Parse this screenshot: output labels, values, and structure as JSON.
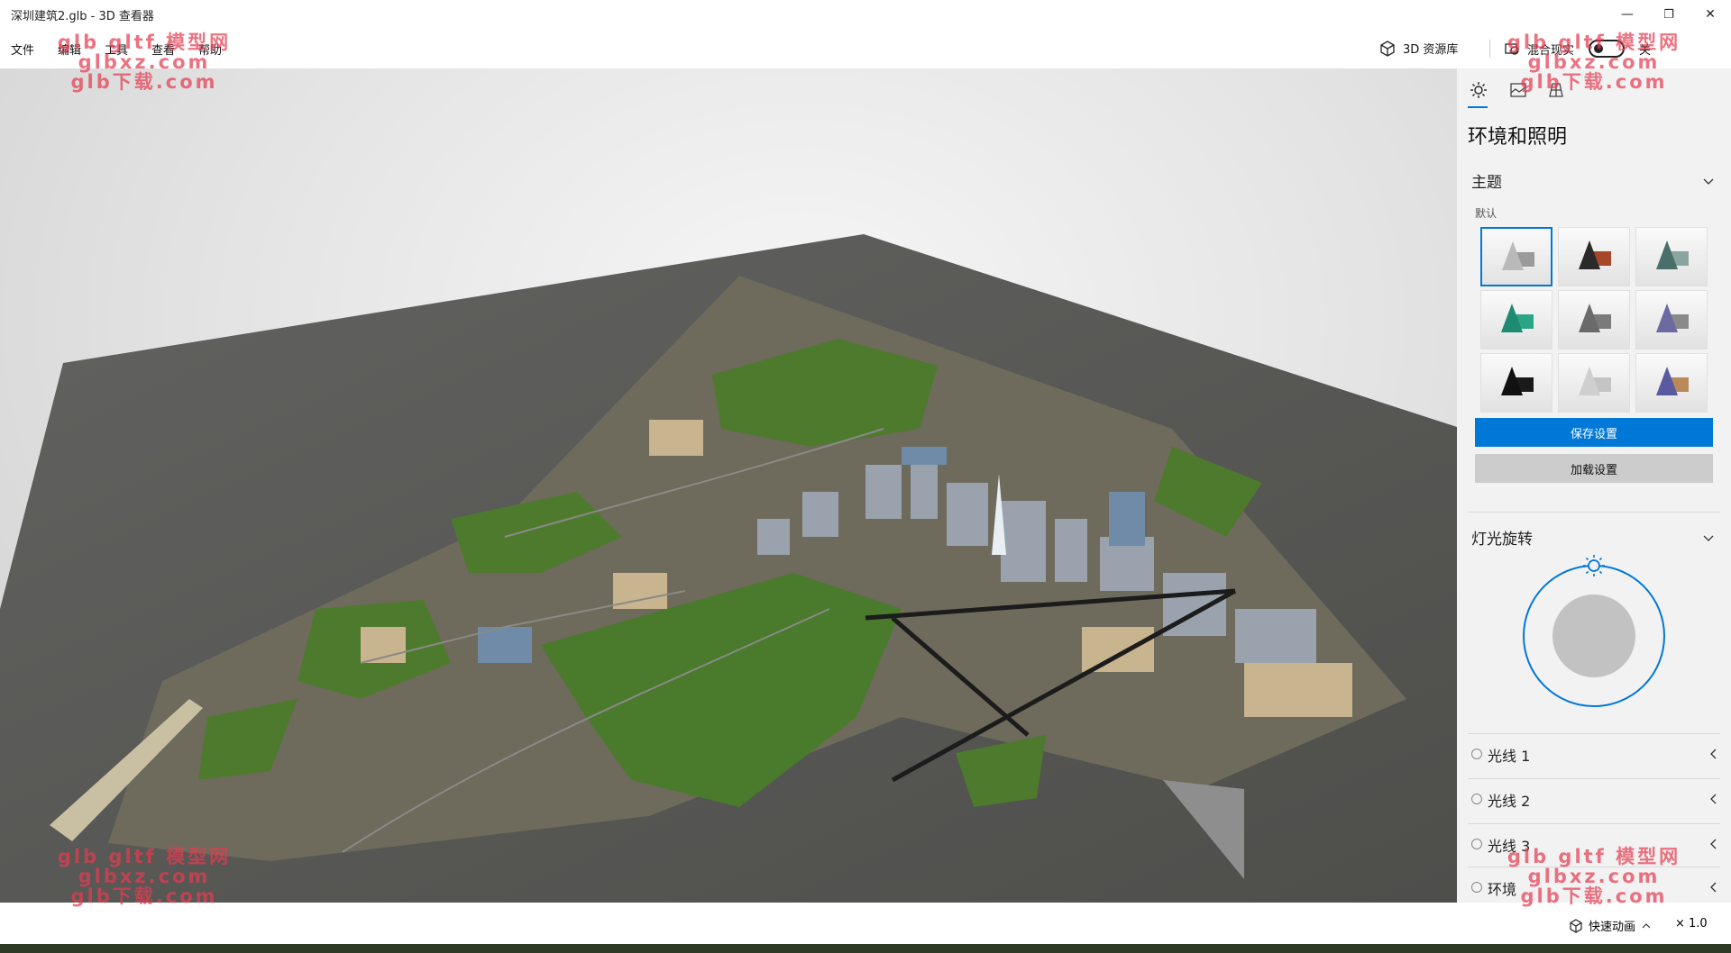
{
  "window": {
    "title": "深圳建筑2.glb - 3D 查看器",
    "minimize": "—",
    "restore": "❐",
    "close": "✕"
  },
  "menu": {
    "items": [
      "文件",
      "编辑",
      "工具",
      "查看",
      "帮助"
    ],
    "library_label": "3D 资源库",
    "mixed_reality_label": "混合现实",
    "toggle_state": "关"
  },
  "panel": {
    "title": "环境和照明",
    "tabs": [
      "sun-icon",
      "environment-icon",
      "grid-icon"
    ],
    "theme_section": "主题",
    "theme_default_label": "默认",
    "themes": [
      {
        "cone": "#b9b9b9",
        "box": "#9a9a9a"
      },
      {
        "cone": "#2a2a2a",
        "box": "#a8462a"
      },
      {
        "cone": "#4a6e6a",
        "box": "#8aa4a0"
      },
      {
        "cone": "#1f8a72",
        "box": "#2aa585"
      },
      {
        "cone": "#6a6a6a",
        "box": "#7a7a7a"
      },
      {
        "cone": "#6c6aa0",
        "box": "#8a8a8a"
      },
      {
        "cone": "#111111",
        "box": "#1a1a1a"
      },
      {
        "cone": "#cfcfcf",
        "box": "#c4c4c4"
      },
      {
        "cone": "#5a5aa0",
        "box": "#b88a5a"
      }
    ],
    "save_button": "保存设置",
    "load_button": "加载设置",
    "light_rotation_section": "灯光旋转",
    "lights": [
      "光线 1",
      "光线 2",
      "光线 3",
      "环境"
    ]
  },
  "status": {
    "quick_animation": "快速动画",
    "speed": "× 1.0"
  },
  "watermark": {
    "line1": "glb gltf 模型网",
    "line2": "glbxz.com",
    "line3": "glb下载.com"
  },
  "colors": {
    "accent": "#0078d7",
    "ground": "#5a5a56",
    "park_green": "#4e7a2e"
  }
}
